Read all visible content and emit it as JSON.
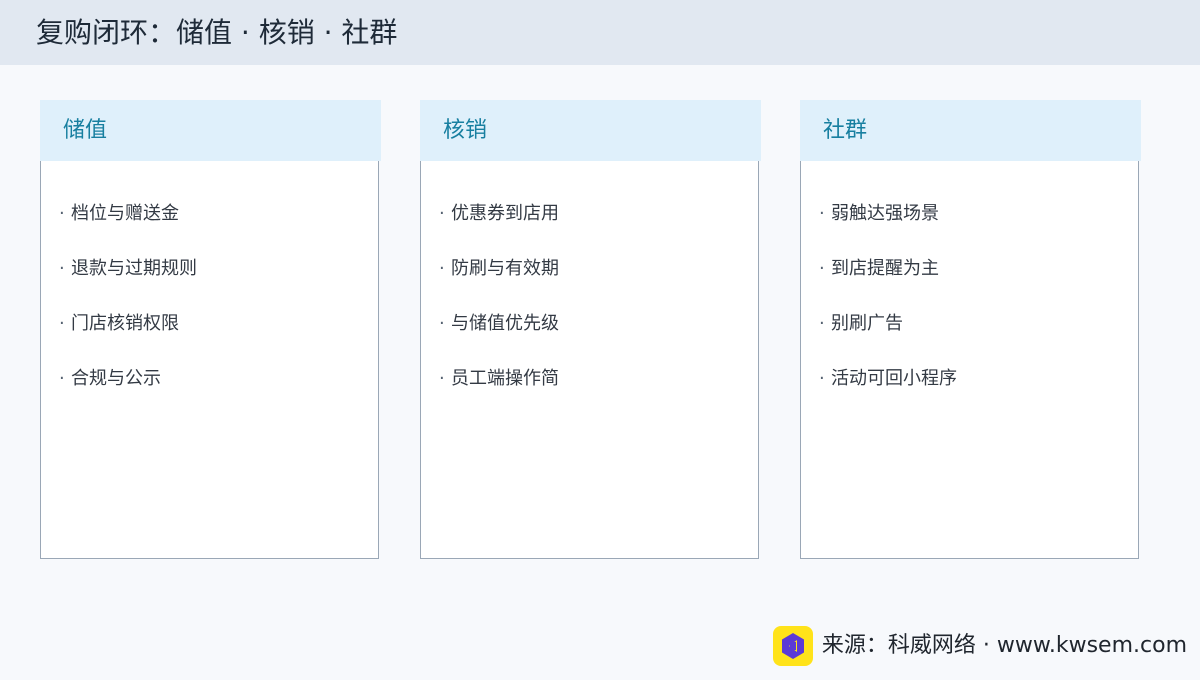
{
  "header": {
    "title": "复购闭环：储值 · 核销 · 社群"
  },
  "cards": [
    {
      "title": "储值",
      "items": [
        "档位与赠送金",
        "退款与过期规则",
        "门店核销权限",
        "合规与公示"
      ]
    },
    {
      "title": "核销",
      "items": [
        "优惠券到店用",
        "防刷与有效期",
        "与储值优先级",
        "员工端操作简"
      ]
    },
    {
      "title": "社群",
      "items": [
        "弱触达强场景",
        "到店提醒为主",
        "别刷广告",
        "活动可回小程序"
      ]
    }
  ],
  "footer": {
    "bullet": "·",
    "source_text": "来源：科威网络 · www.kwsem.com",
    "logo_icon": "kwsem-logo-icon"
  },
  "colors": {
    "header_bg": "#e1e8f1",
    "card_header_bg": "#dff0fb",
    "card_title": "#177fa0",
    "logo_yellow": "#ffe31a",
    "logo_purple": "#5b3ad6"
  }
}
